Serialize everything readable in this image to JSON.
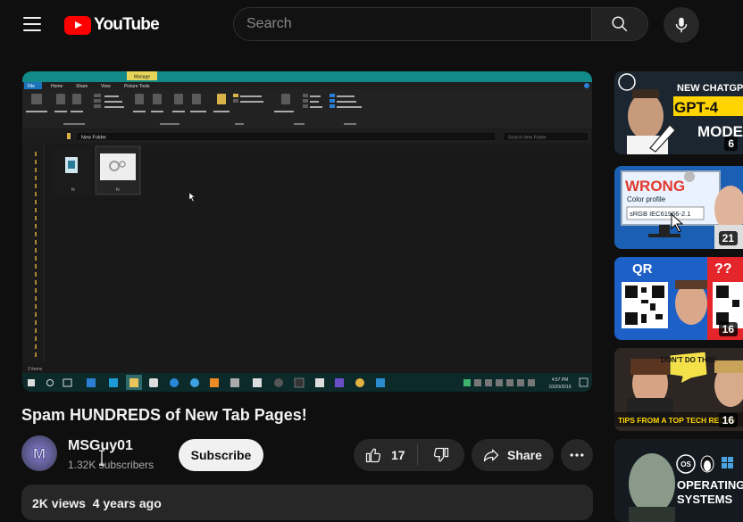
{
  "masthead": {
    "logo_text": "YouTube",
    "search_placeholder": "Search"
  },
  "video": {
    "title": "Spam HUNDREDS of New Tab Pages!",
    "channel": "MSGuy01",
    "subscribers": "1.32K subscribers",
    "subscribe_label": "Subscribe",
    "likes": "17",
    "share_label": "Share",
    "views_age": "2K views  4 years ago"
  },
  "player_frame": {
    "ribbon_tabs": [
      "File",
      "Home",
      "Share",
      "View",
      "Picture Tools"
    ],
    "manage_tab": "Manage",
    "address_path": "New Folder",
    "search_box": "Search New Folder",
    "clock_time": "4:57 PM",
    "clock_date": "10/20/2019",
    "status_text": "2 items",
    "file_names": [
      "fv",
      "fv"
    ]
  },
  "sidebar": {
    "items": [
      {
        "thumb_text": "NEW CHATGPT",
        "thumb_text2": "GPT-4",
        "thumb_text3": "MODE",
        "duration": "6",
        "accent": "#ffd400"
      },
      {
        "thumb_text": "WRONG",
        "thumb_text2": "Color profile",
        "thumb_text3": "sRGB IEC61966-2.1",
        "duration": "21",
        "accent": "#e23b2e"
      },
      {
        "thumb_text": "QR",
        "thumb_text2": "??",
        "duration": "16",
        "accent": "#e4262b"
      },
      {
        "thumb_text": "DON'T DO THIS!",
        "thumb_text2": "TIPS FROM A TOP TECH RECRU",
        "duration": "16",
        "accent": "#ffd400"
      },
      {
        "thumb_text": "OPERATING",
        "thumb_text2": "SYSTEMS",
        "thumb_text3": "OS",
        "accent": "#ffffff"
      }
    ]
  }
}
